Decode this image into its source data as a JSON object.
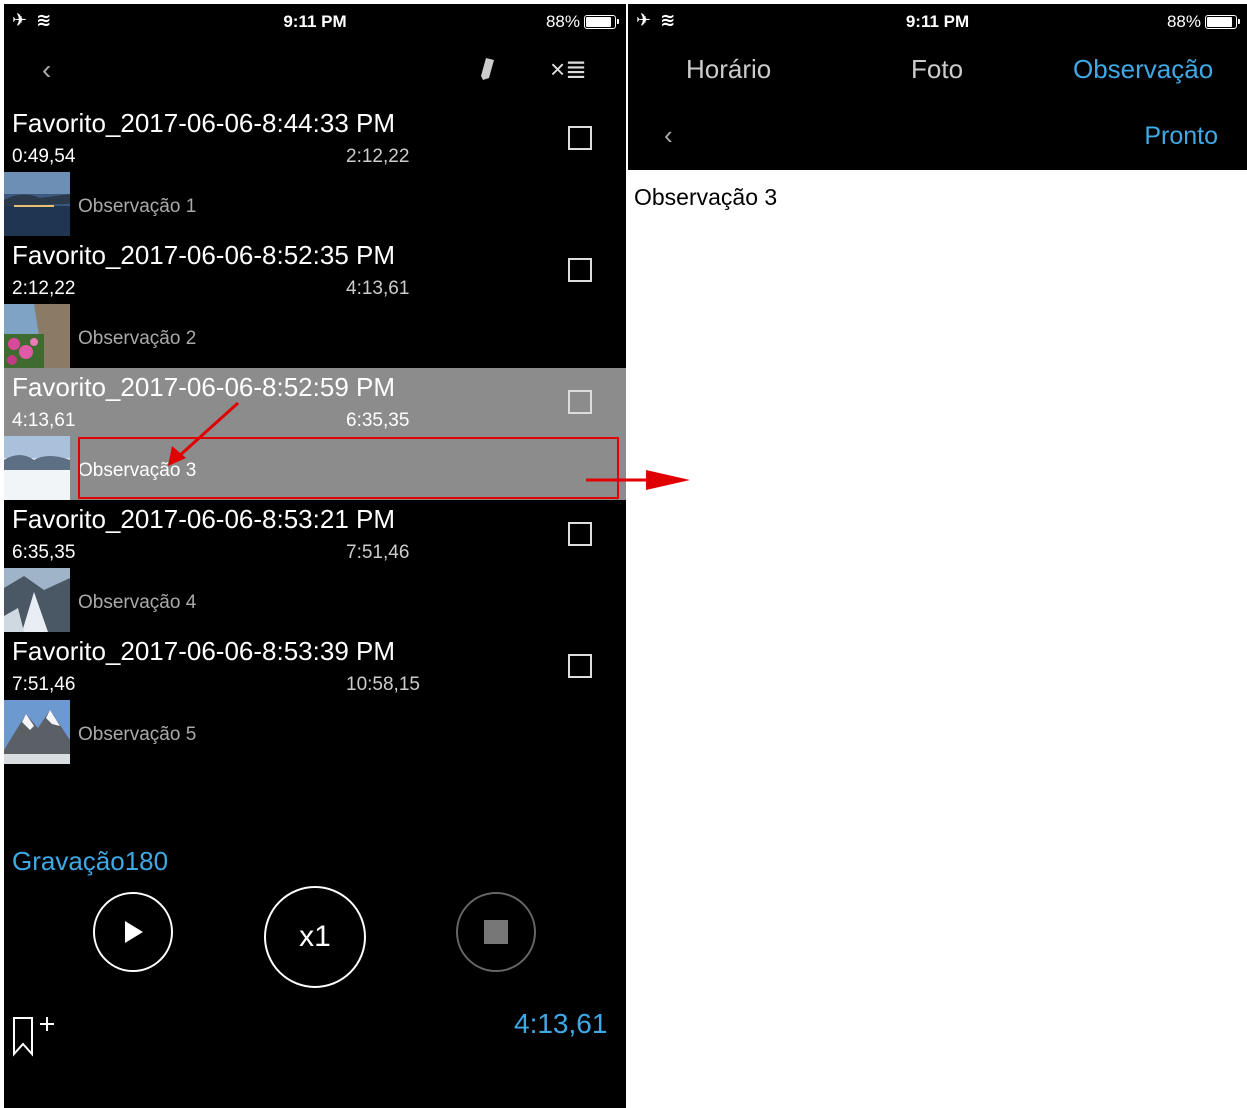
{
  "left": {
    "status": {
      "signal": "✈ ≋",
      "time": "9:11 PM",
      "battery": "88%",
      "battery_level": 0.88
    },
    "nav": {
      "back": "‹",
      "clear_list": "×≣"
    },
    "entries": [
      {
        "title": "Favorito_2017-06-06-8:44:33 PM",
        "start": "0:49,54",
        "end": "2:12,22",
        "note": "Observação 1",
        "thumb_icon": "night-harbor-photo"
      },
      {
        "title": "Favorito_2017-06-06-8:52:35 PM",
        "start": "2:12,22",
        "end": "4:13,61",
        "note": "Observação 2",
        "thumb_icon": "flowers-photo"
      },
      {
        "title": "Favorito_2017-06-06-8:52:59 PM",
        "start": "4:13,61",
        "end": "6:35,35",
        "note": "Observação 3",
        "thumb_icon": "snow-clouds-photo"
      },
      {
        "title": "Favorito_2017-06-06-8:53:21 PM",
        "start": "6:35,35",
        "end": "7:51,46",
        "note": "Observação 4",
        "thumb_icon": "glacier-photo"
      },
      {
        "title": "Favorito_2017-06-06-8:53:39 PM",
        "start": "7:51,46",
        "end": "10:58,15",
        "note": "Observação 5",
        "thumb_icon": "mountain-photo"
      }
    ],
    "recording_name": "Gravação180",
    "speed_label": "x1",
    "elapsed": "4:13,61"
  },
  "right": {
    "status": {
      "signal": "✈ ≋",
      "time": "9:11 PM",
      "battery": "88%",
      "battery_level": 0.88
    },
    "tabs": [
      "Horário",
      "Foto",
      "Observação"
    ],
    "back": "‹",
    "done_label": "Pronto",
    "note_text": "Observação 3"
  },
  "colors": {
    "accent": "#3fa9e6",
    "highlight": "#e00000",
    "selected_row": "#8c8c8c"
  }
}
